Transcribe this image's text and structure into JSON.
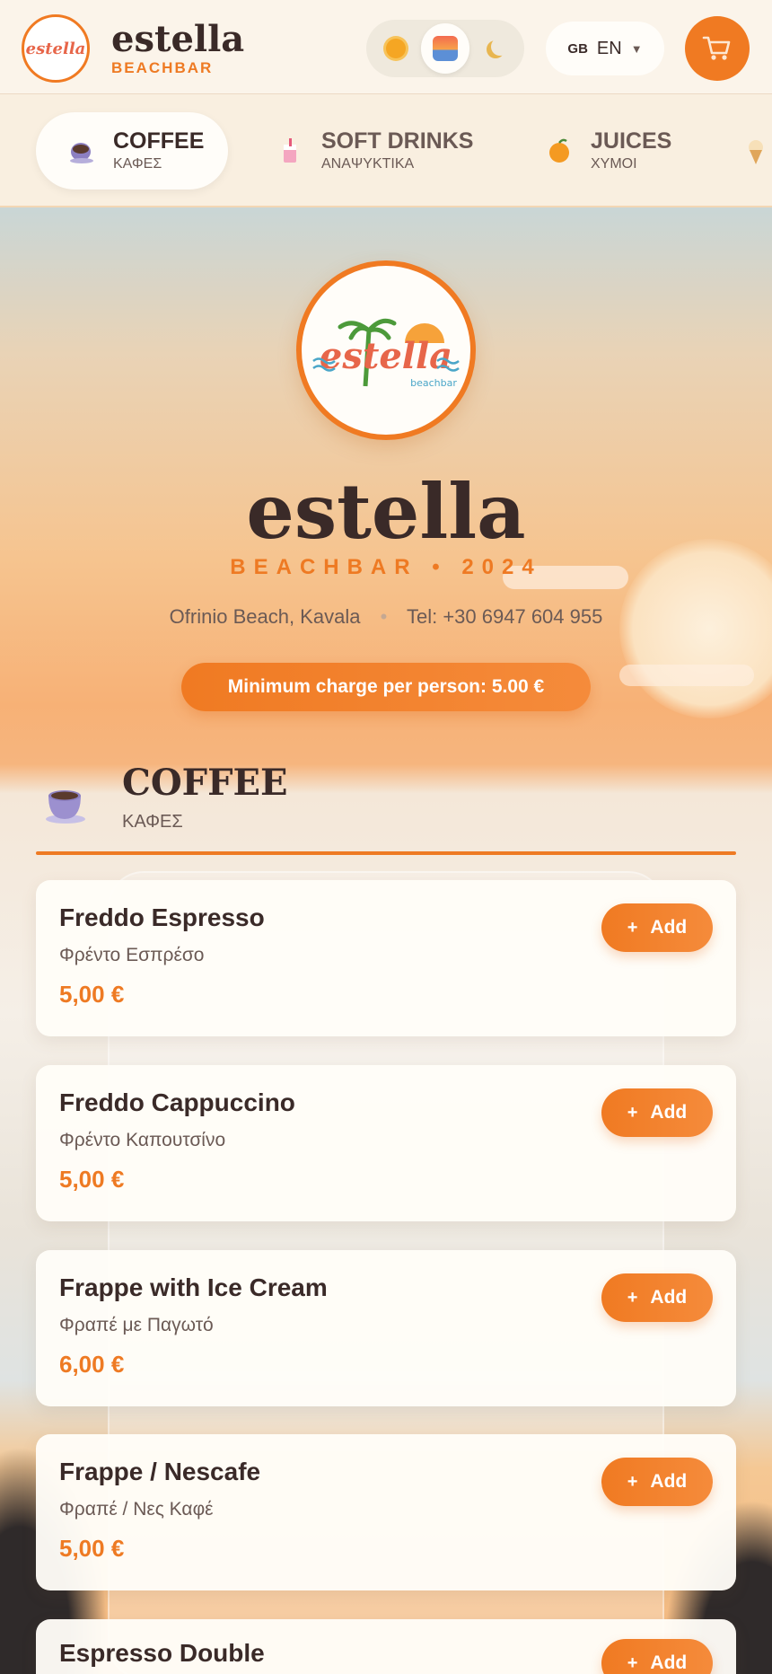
{
  "header": {
    "logo_text": "estella",
    "brand_name": "estella",
    "brand_sub": "BEACHBAR",
    "theme_modes": [
      "day",
      "sunset",
      "night"
    ],
    "language": {
      "flag": "GB",
      "code": "EN"
    },
    "cart_icon": "cart-icon"
  },
  "categories": [
    {
      "title": "COFFEE",
      "subtitle": "ΚΑΦΕΣ",
      "icon": "coffee-cup-icon"
    },
    {
      "title": "SOFT DRINKS",
      "subtitle": "ΑΝΑΨΥΚΤΙΚΑ",
      "icon": "soda-cup-icon"
    },
    {
      "title": "JUICES",
      "subtitle": "ΧΥΜΟΙ",
      "icon": "orange-icon"
    }
  ],
  "hero": {
    "logo_text": "estella",
    "logo_tagline": "beachbar",
    "title": "estella",
    "subtitle": "BEACHBAR • 2024",
    "location": "Ofrinio Beach, Kavala",
    "separator": "•",
    "phone": "Tel: +30 6947 604 955",
    "min_charge": "Minimum charge per person: 5.00 €"
  },
  "section": {
    "title": "COFFEE",
    "subtitle": "ΚΑΦΕΣ"
  },
  "add_label": "Add",
  "add_plus": "+",
  "items": [
    {
      "name": "Freddo Espresso",
      "name_gr": "Φρέντο Εσπρέσο",
      "price": "5,00 €"
    },
    {
      "name": "Freddo Cappuccino",
      "name_gr": "Φρέντο Καπουτσίνο",
      "price": "5,00 €"
    },
    {
      "name": "Frappe with Ice Cream",
      "name_gr": "Φραπέ με Παγωτό",
      "price": "6,00 €"
    },
    {
      "name": "Frappe / Nescafe",
      "name_gr": "Φραπέ / Νες Καφέ",
      "price": "5,00 €"
    },
    {
      "name": "Espresso Double",
      "name_gr": "",
      "price": ""
    }
  ],
  "colors": {
    "accent": "#ee7a23",
    "text": "#3a2a28",
    "muted": "#6b5a55"
  }
}
